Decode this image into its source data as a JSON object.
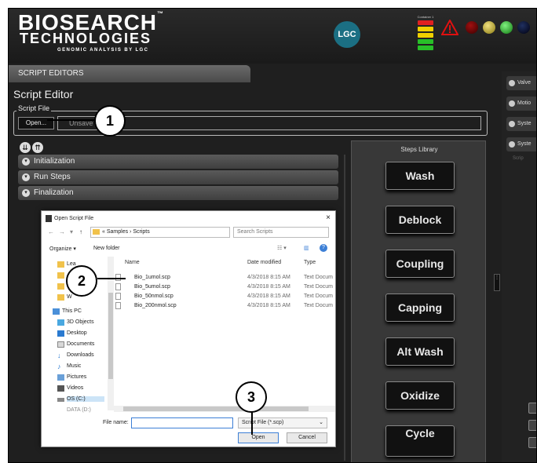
{
  "brand": {
    "line1": "BIOSEARCH",
    "tm": "™",
    "line2": "TECHNOLOGIES",
    "tagline": "GENOMIC ANALYSIS BY LGC",
    "partner_logo": "LGC"
  },
  "status": {
    "container_label": "Container 1"
  },
  "tab": {
    "label": "SCRIPT EDITORS"
  },
  "editor": {
    "title": "Script Editor",
    "script_file_label": "Script File",
    "open_button": "Open...",
    "file_path": "Unsave",
    "sections": [
      {
        "label": "Initialization"
      },
      {
        "label": "Run Steps"
      },
      {
        "label": "Finalization"
      }
    ]
  },
  "steps_library": {
    "title": "Steps Library",
    "steps": [
      "Wash",
      "Deblock",
      "Coupling",
      "Capping",
      "Alt Wash",
      "Oxidize",
      "Cycle"
    ]
  },
  "right_panel": {
    "items": [
      "Valve",
      "Motio",
      "Syste",
      "Syste"
    ],
    "sub_item": "Scrip"
  },
  "dialog": {
    "title": "Open Script File",
    "close": "×",
    "breadcrumb": [
      "«",
      "Samples",
      "›",
      "Scripts"
    ],
    "search_placeholder": "Search Scripts",
    "toolbar": {
      "organize": "Organize ▾",
      "new_folder": "New folder"
    },
    "nav_items": [
      {
        "label": "Lea",
        "icon": "folder-icon"
      },
      {
        "label": "",
        "icon": "folder-icon"
      },
      {
        "label": "",
        "icon": "folder-icon"
      },
      {
        "label": "W",
        "icon": "folder-icon"
      },
      {
        "label": "This PC",
        "icon": "computer-icon"
      },
      {
        "label": "3D Objects",
        "icon": "cube-icon"
      },
      {
        "label": "Desktop",
        "icon": "desktop-icon"
      },
      {
        "label": "Documents",
        "icon": "document-icon"
      },
      {
        "label": "Downloads",
        "icon": "download-icon"
      },
      {
        "label": "Music",
        "icon": "music-icon"
      },
      {
        "label": "Pictures",
        "icon": "picture-icon"
      },
      {
        "label": "Videos",
        "icon": "video-icon"
      },
      {
        "label": "OS (C:)",
        "icon": "drive-icon"
      },
      {
        "label": "DATA (D:)",
        "icon": "drive-icon"
      }
    ],
    "columns": {
      "name": "Name",
      "date": "Date modified",
      "type": "Type"
    },
    "files": [
      {
        "name": "Bio_1umol.scp",
        "date": "4/3/2018 8:15 AM",
        "type": "Text Docum"
      },
      {
        "name": "Bio_5umol.scp",
        "date": "4/3/2018 8:15 AM",
        "type": "Text Docum"
      },
      {
        "name": "Bio_50nmol.scp",
        "date": "4/3/2018 8:15 AM",
        "type": "Text Docum"
      },
      {
        "name": "Bio_200nmol.scp",
        "date": "4/3/2018 8:15 AM",
        "type": "Text Docum"
      }
    ],
    "file_name_label": "File name:",
    "file_name_value": "",
    "file_type": "Script File (*.scp)",
    "open_button": "Open",
    "cancel_button": "Cancel"
  },
  "callouts": [
    "1",
    "2",
    "3"
  ],
  "colors": {
    "app_bg": "#1f1f1f",
    "accent_blue": "#3c7fd6",
    "lgc_teal": "#1b6f83"
  }
}
